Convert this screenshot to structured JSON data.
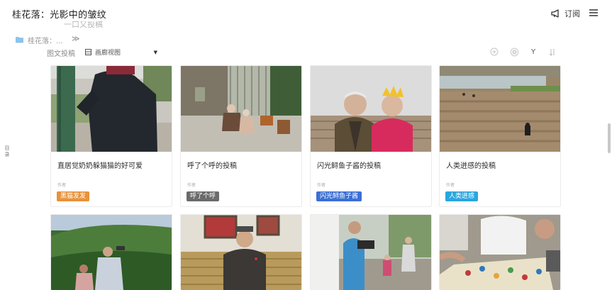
{
  "header": {
    "title": "桂花落：光影中的皱纹",
    "subscribe_label": "订阅",
    "faint_text": "一口又投稿",
    "breadcrumb": "桂花落：..."
  },
  "toolbar": {
    "view_label": "图文投稿",
    "view_select": "画廊视图",
    "y_label": "Y",
    "icons": [
      "add-circle-icon",
      "settings-circle-icon",
      "filter-icon",
      "sort-icon"
    ]
  },
  "toc_label": "目录",
  "field_label": "作者",
  "cards": [
    {
      "title": "直居觉奶奶躲猫猫的好可爱",
      "tag": "黑猫发发",
      "tag_color": "#e8923a"
    },
    {
      "title": "呼了个呼的投稿",
      "tag": "呼了个呼",
      "tag_color": "#6b6b6b"
    },
    {
      "title": "闪光鲟鱼子酱的投稿",
      "tag": "闪光鲟鱼子酱",
      "tag_color": "#3b6fd6"
    },
    {
      "title": "人类迸感的投稿",
      "tag": "人类迸感",
      "tag_color": "#2aa6e0"
    }
  ],
  "colors": {
    "accent_blue": "#3b6fd6",
    "border": "#ebebeb"
  }
}
